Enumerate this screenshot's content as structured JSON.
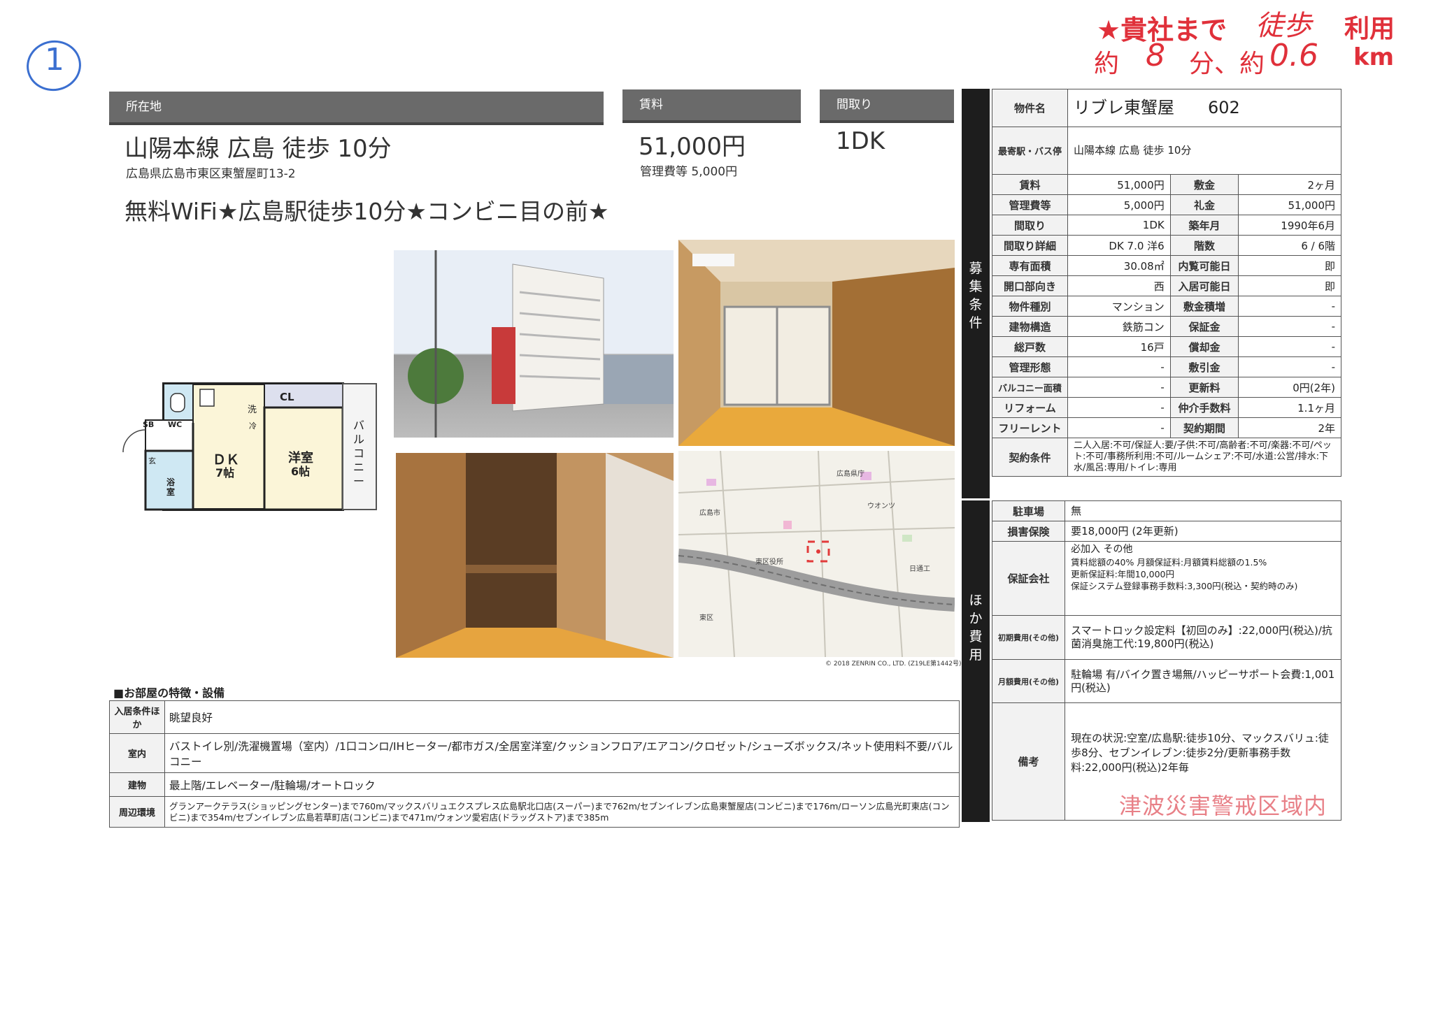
{
  "handwriting": {
    "circle_number": "1",
    "note_line1": "★貴社まで",
    "note_walk": "徒歩",
    "note_use": "利用",
    "note_line2a": "約",
    "note_minutes": "8",
    "note_line2b": "分、約",
    "note_km_value": "0.6",
    "note_km_unit": "km"
  },
  "header": {
    "location_label": "所在地",
    "rent_label": "賃料",
    "layout_label": "間取り",
    "station": "山陽本線 広島 徒歩 10分",
    "address": "広島県広島市東区東蟹屋町13-2",
    "rent": "51,000円",
    "mgmt_fee": "管理費等 5,000円",
    "layout": "1DK",
    "catchcopy": "無料WiFi★広島駅徒歩10分★コンビニ目の前★"
  },
  "floorplan": {
    "cl": "CL",
    "wc": "WC",
    "sb": "SB",
    "wash": "洗",
    "frig": "冷",
    "entrance": "玄",
    "bath": "浴室",
    "dk": "ＤＫ",
    "dk_size": "7帖",
    "room": "洋室",
    "room_size": "6帖",
    "balcony": "バルコニー"
  },
  "map": {
    "copyright": "© 2018 ZENRIN CO., LTD. (Z19LE第1442号)",
    "labels": [
      "広島県庁",
      "東区役所",
      "広島市",
      "ウオンツ",
      "日通工",
      "東区"
    ]
  },
  "features": {
    "title": "■お部屋の特徴・設備",
    "rows": [
      {
        "label": "入居条件ほか",
        "value": "眺望良好"
      },
      {
        "label": "室内",
        "value": "バストイレ別/洗濯機置場（室内）/1口コンロ/IHヒーター/都市ガス/全居室洋室/クッションフロア/エアコン/クロゼット/シューズボックス/ネット使用料不要/バルコニー"
      },
      {
        "label": "建物",
        "value": "最上階/エレベーター/駐輪場/オートロック"
      },
      {
        "label": "周辺環境",
        "value": "グランアークテラス(ショッピングセンター)まで760m/マックスバリュエクスプレス広島駅北口店(スーパー)まで762m/セブンイレブン広島東蟹屋店(コンビニ)まで176m/ローソン広島光町東店(コンビニ)まで354m/セブンイレブン広島若草町店(コンビニ)まで471m/ウォンツ愛宕店(ドラッグストア)まで385m"
      }
    ]
  },
  "spec": {
    "side1": [
      "募",
      "集",
      "条",
      "件"
    ],
    "side2": [
      "ほ",
      "か",
      "費",
      "用"
    ],
    "name_label": "物件名",
    "name_value": "リブレ東蟹屋　　602",
    "station_label": "最寄駅・バス停",
    "station_value": "山陽本線 広島 徒歩 10分",
    "rows": [
      [
        "賃料",
        "51,000円",
        "敷金",
        "2ヶ月"
      ],
      [
        "管理費等",
        "5,000円",
        "礼金",
        "51,000円"
      ],
      [
        "間取り",
        "1DK",
        "築年月",
        "1990年6月"
      ],
      [
        "間取り詳細",
        "DK 7.0 洋6",
        "階数",
        "6 / 6階"
      ],
      [
        "専有面積",
        "30.08㎡",
        "内覧可能日",
        "即"
      ],
      [
        "開口部向き",
        "西",
        "入居可能日",
        "即"
      ],
      [
        "物件種別",
        "マンション",
        "敷金積増",
        "-"
      ],
      [
        "建物構造",
        "鉄筋コン",
        "保証金",
        "-"
      ],
      [
        "総戸数",
        "16戸",
        "償却金",
        "-"
      ],
      [
        "管理形態",
        "-",
        "敷引金",
        "-"
      ],
      [
        "バルコニー面積",
        "-",
        "更新料",
        "0円(2年)"
      ],
      [
        "リフォーム",
        "-",
        "仲介手数料",
        "1.1ヶ月"
      ],
      [
        "フリーレント",
        "-",
        "契約期間",
        "2年"
      ]
    ],
    "contract_label": "契約条件",
    "contract_value": "二人入居:不可/保証人:要/子供:不可/高齢者:不可/楽器:不可/ペット:不可/事務所利用:不可/ルームシェア:不可/水道:公営/排水:下水/風呂:専用/トイレ:専用",
    "parking_label": "駐車場",
    "parking_value": "無",
    "insurance_label": "損害保険",
    "insurance_value": "要18,000円 (2年更新)",
    "guarantee_label": "保証会社",
    "guarantee_lines": [
      "必加入 その他",
      "賃料総額の40% 月額保証料:月額賃料総額の1.5%",
      "更新保証料:年間10,000円",
      "保証システム登録事務手数料:3,300円(税込・契約時のみ)"
    ],
    "initial_label": "初期費用(その他)",
    "initial_value": "スマートロック設定料【初回のみ】:22,000円(税込)/抗菌消臭施工代:19,800円(税込)",
    "monthly_label": "月額費用(その他)",
    "monthly_value": "駐輪場 有/バイク置き場無/ハッピーサポート会費:1,001円(税込)",
    "remarks_label": "備考",
    "remarks_value": "現在の状況:空室/広島駅:徒歩10分、マックスバリュ:徒歩8分、セブンイレブン:徒歩2分/更新事務手数料:22,000円(税込)2年毎",
    "stamp": "津波災害警戒区域内"
  }
}
